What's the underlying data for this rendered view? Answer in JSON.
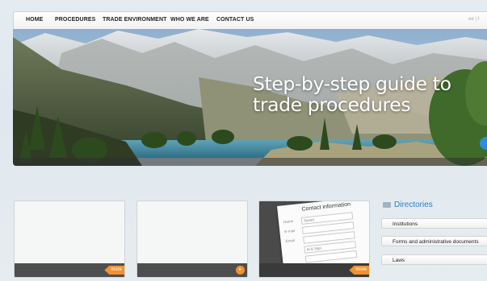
{
  "nav": {
    "items": [
      "HOME",
      "PROCEDURES",
      "TRADE ENVIRONMENT",
      "WHO WE ARE",
      "CONTACT US"
    ],
    "lang": "ee | t"
  },
  "hero": {
    "line1": "Step-by-step guide to",
    "line2": "trade procedures",
    "colors": {
      "sky": "#9cb9d4",
      "lake": "#4d8fa6",
      "text": "#ffffff"
    }
  },
  "cards": [
    {
      "action": "more"
    },
    {
      "action": "▸"
    },
    {
      "action": "more",
      "form": {
        "title": "Contact information",
        "rows": [
          {
            "label": "Name",
            "value": "Saved"
          },
          {
            "label": "E-mail",
            "value": ""
          },
          {
            "label": "Email",
            "value": ""
          },
          {
            "label": "",
            "value": "Id & Sign"
          },
          {
            "label": "",
            "value": ""
          }
        ]
      }
    }
  ],
  "directories": {
    "title": "Directories",
    "items": [
      "Institutions",
      "Forms and administrative documents",
      "Laws"
    ]
  },
  "colors": {
    "accent": "#f0922e",
    "link": "#2a7fc9",
    "bar": "#4e4e4e"
  }
}
